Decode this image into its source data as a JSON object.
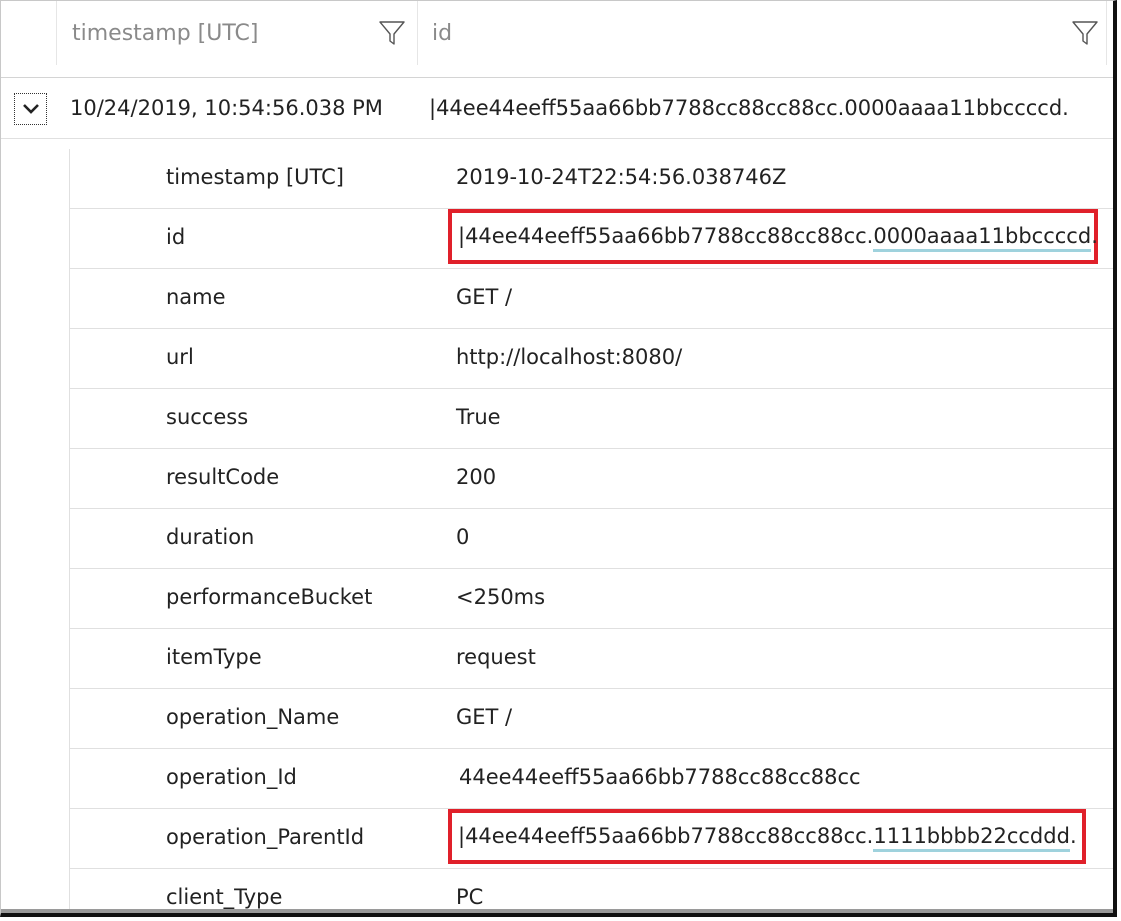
{
  "header": {
    "col_timestamp": "timestamp [UTC]",
    "col_id": "id"
  },
  "summary": {
    "timestamp": "10/24/2019, 10:54:56.038 PM",
    "id": "|44ee44eeff55aa66bb7788cc88cc88cc.0000aaaa11bbccccd."
  },
  "details": {
    "timestamp": {
      "key": "timestamp [UTC]",
      "value": "2019-10-24T22:54:56.038746Z"
    },
    "id": {
      "key": "id",
      "value_prefix": "|44ee44eeff55aa66bb7788cc88cc88cc.",
      "value_highlight": "0000aaaa11bbccccd",
      "value_suffix": "."
    },
    "name": {
      "key": "name",
      "value": "GET /"
    },
    "url": {
      "key": "url",
      "value": "http://localhost:8080/"
    },
    "success": {
      "key": "success",
      "value": "True"
    },
    "resultCode": {
      "key": "resultCode",
      "value": "200"
    },
    "duration": {
      "key": "duration",
      "value": "0"
    },
    "performanceBucket": {
      "key": "performanceBucket",
      "value": "<250ms"
    },
    "itemType": {
      "key": "itemType",
      "value": "request"
    },
    "operation_Name": {
      "key": "operation_Name",
      "value": "GET /"
    },
    "operation_Id": {
      "key": "operation_Id",
      "value": "44ee44eeff55aa66bb7788cc88cc88cc"
    },
    "operation_ParentId": {
      "key": "operation_ParentId",
      "value_prefix": "|44ee44eeff55aa66bb7788cc88cc88cc.",
      "value_highlight": "1111bbbb22ccddd",
      "value_suffix": "."
    },
    "client_Type": {
      "key": "client_Type",
      "value": "PC"
    }
  },
  "colors": {
    "highlight_border": "#e0202a",
    "underline": "#9fd2dd"
  },
  "icons": {
    "filter": "funnel-icon",
    "expand": "chevron-down-icon"
  }
}
